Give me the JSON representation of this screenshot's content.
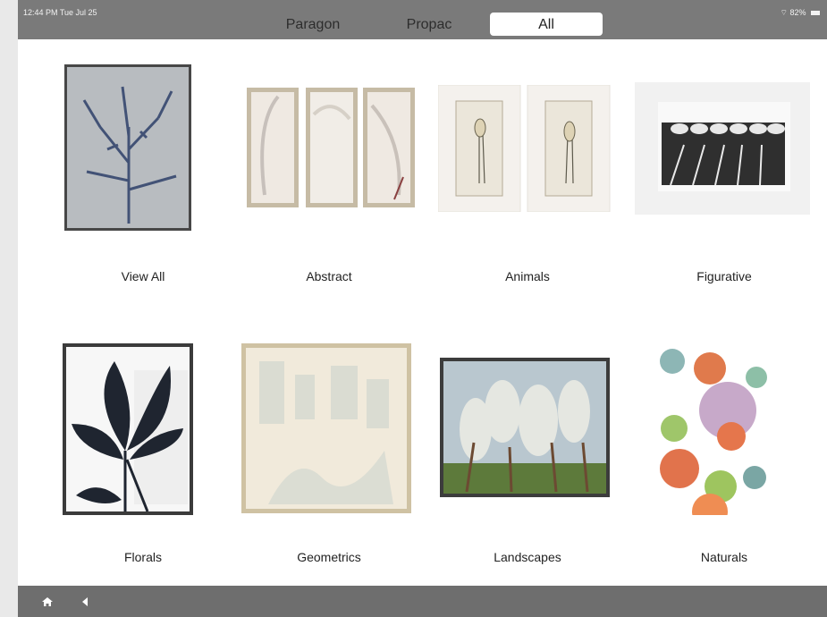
{
  "status_bar": {
    "time": "12:44 PM  Tue Jul 25",
    "battery": "82%"
  },
  "tabs": [
    {
      "label": "Paragon",
      "selected": false
    },
    {
      "label": "Propac",
      "selected": false
    },
    {
      "label": "All",
      "selected": true
    }
  ],
  "categories": [
    {
      "label": "View All"
    },
    {
      "label": "Abstract"
    },
    {
      "label": "Animals"
    },
    {
      "label": "Figurative"
    },
    {
      "label": "Florals"
    },
    {
      "label": "Geometrics"
    },
    {
      "label": "Landscapes"
    },
    {
      "label": "Naturals"
    }
  ],
  "nav": {
    "home_icon": "home-icon",
    "back_icon": "back-icon"
  },
  "colors": {
    "bars": "#7a7a7a",
    "selected_tab": "#ffffff",
    "text": "#222222"
  }
}
